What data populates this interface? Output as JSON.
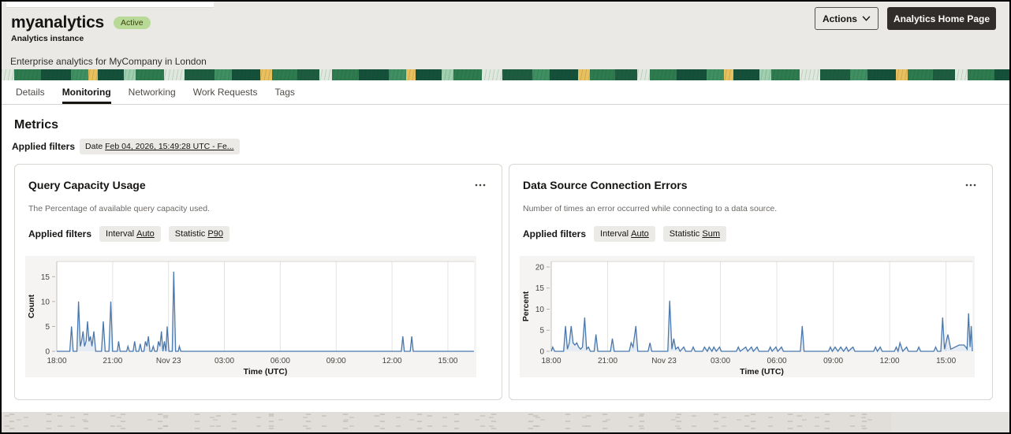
{
  "header": {
    "title": "myanalytics",
    "status_badge": "Active",
    "subtitle": "Analytics instance",
    "description": "Enterprise analytics for MyCompany in London",
    "actions_button": "Actions",
    "home_button": "Analytics Home Page"
  },
  "tabs": {
    "items": [
      {
        "label": "Details",
        "active": false
      },
      {
        "label": "Monitoring",
        "active": true
      },
      {
        "label": "Networking",
        "active": false
      },
      {
        "label": "Work Requests",
        "active": false
      },
      {
        "label": "Tags",
        "active": false
      }
    ]
  },
  "metrics": {
    "heading": "Metrics",
    "applied_filters_label": "Applied filters",
    "date_filter_prefix": "Date",
    "date_filter_value": "Feb 04, 2026, 15:49:28 UTC - Fe..."
  },
  "chart_data": [
    {
      "type": "line",
      "title": "Query Capacity Usage",
      "subtitle": "The Percentage of available query capacity used.",
      "applied_filters_label": "Applied filters",
      "filters": [
        {
          "label": "Interval",
          "value": "Auto"
        },
        {
          "label": "Statistic",
          "value": "P90"
        }
      ],
      "menu_icon": "ellipsis",
      "xlabel": "Time (UTC)",
      "ylabel": "Count",
      "yticks": [
        0,
        5,
        10,
        15
      ],
      "ylim": [
        0,
        18.05
      ],
      "xlim": [
        0,
        22.4
      ],
      "grid": true,
      "legend": "none",
      "line_color": "#4a78ad",
      "xticks": [
        {
          "h": 0,
          "label": "18:00"
        },
        {
          "h": 3,
          "label": "21:00"
        },
        {
          "h": 6,
          "label": "Nov 23"
        },
        {
          "h": 9,
          "label": "03:00"
        },
        {
          "h": 12,
          "label": "06:00"
        },
        {
          "h": 15,
          "label": "09:00"
        },
        {
          "h": 18,
          "label": "12:00"
        },
        {
          "h": 21,
          "label": "15:00"
        }
      ],
      "points": [
        [
          0,
          0
        ],
        [
          0.7,
          0
        ],
        [
          0.79,
          5
        ],
        [
          0.88,
          0
        ],
        [
          1.08,
          0
        ],
        [
          1.17,
          10
        ],
        [
          1.26,
          1
        ],
        [
          1.33,
          2
        ],
        [
          1.41,
          4
        ],
        [
          1.49,
          1
        ],
        [
          1.57,
          2
        ],
        [
          1.65,
          6
        ],
        [
          1.73,
          2
        ],
        [
          1.81,
          3
        ],
        [
          1.89,
          1
        ],
        [
          1.99,
          4
        ],
        [
          2.09,
          0
        ],
        [
          2.4,
          0
        ],
        [
          2.5,
          6
        ],
        [
          2.6,
          0
        ],
        [
          2.8,
          0
        ],
        [
          2.9,
          10
        ],
        [
          3.0,
          0
        ],
        [
          3.25,
          0
        ],
        [
          3.32,
          2
        ],
        [
          3.4,
          0
        ],
        [
          3.75,
          0
        ],
        [
          3.82,
          1
        ],
        [
          3.9,
          0
        ],
        [
          4.1,
          0
        ],
        [
          4.18,
          2
        ],
        [
          4.26,
          0
        ],
        [
          4.4,
          0
        ],
        [
          4.48,
          1.5
        ],
        [
          4.56,
          0
        ],
        [
          4.68,
          0
        ],
        [
          4.76,
          2
        ],
        [
          4.84,
          1
        ],
        [
          4.92,
          3
        ],
        [
          5.0,
          0
        ],
        [
          5.1,
          0
        ],
        [
          5.18,
          1
        ],
        [
          5.26,
          0
        ],
        [
          5.38,
          0
        ],
        [
          5.46,
          2
        ],
        [
          5.54,
          1
        ],
        [
          5.62,
          4
        ],
        [
          5.7,
          0
        ],
        [
          5.78,
          2
        ],
        [
          5.86,
          0
        ],
        [
          5.93,
          5
        ],
        [
          6.02,
          0
        ],
        [
          6.2,
          0
        ],
        [
          6.28,
          16
        ],
        [
          6.38,
          0
        ],
        [
          6.52,
          0
        ],
        [
          6.58,
          1
        ],
        [
          6.66,
          0
        ],
        [
          18.5,
          0
        ],
        [
          18.58,
          3
        ],
        [
          18.66,
          0
        ],
        [
          18.98,
          0
        ],
        [
          19.06,
          3
        ],
        [
          19.14,
          0
        ],
        [
          22.4,
          0
        ]
      ]
    },
    {
      "type": "line",
      "title": "Data Source Connection Errors",
      "subtitle": "Number of times an error occurred while connecting to a data source.",
      "applied_filters_label": "Applied filters",
      "filters": [
        {
          "label": "Interval",
          "value": "Auto"
        },
        {
          "label": "Statistic",
          "value": "Sum"
        }
      ],
      "menu_icon": "ellipsis",
      "xlabel": "Time (UTC)",
      "ylabel": "Percent",
      "yticks": [
        0,
        5,
        10,
        15,
        20
      ],
      "ylim": [
        0,
        21.3
      ],
      "xlim": [
        0,
        22.4
      ],
      "grid": true,
      "legend": "none",
      "line_color": "#4a78ad",
      "xticks": [
        {
          "h": 0,
          "label": "18:00"
        },
        {
          "h": 3,
          "label": "21:00"
        },
        {
          "h": 6,
          "label": "Nov 23"
        },
        {
          "h": 9,
          "label": "03:00"
        },
        {
          "h": 12,
          "label": "06:00"
        },
        {
          "h": 15,
          "label": "09:00"
        },
        {
          "h": 18,
          "label": "12:00"
        },
        {
          "h": 21,
          "label": "15:00"
        }
      ],
      "points": [
        [
          0,
          0
        ],
        [
          0.08,
          1
        ],
        [
          0.18,
          0
        ],
        [
          0.66,
          0
        ],
        [
          0.76,
          6
        ],
        [
          0.86,
          0.5
        ],
        [
          0.96,
          2
        ],
        [
          1.06,
          6
        ],
        [
          1.16,
          2
        ],
        [
          1.26,
          1.5
        ],
        [
          1.36,
          2
        ],
        [
          1.46,
          1
        ],
        [
          1.56,
          0.5
        ],
        [
          1.66,
          1
        ],
        [
          1.78,
          8
        ],
        [
          1.88,
          0.5
        ],
        [
          1.98,
          1
        ],
        [
          2.08,
          0
        ],
        [
          2.28,
          0
        ],
        [
          2.38,
          4
        ],
        [
          2.48,
          0
        ],
        [
          3.15,
          0
        ],
        [
          3.25,
          3
        ],
        [
          3.35,
          0
        ],
        [
          4.15,
          0
        ],
        [
          4.25,
          2
        ],
        [
          4.35,
          1
        ],
        [
          4.5,
          6
        ],
        [
          4.6,
          0
        ],
        [
          5.15,
          0
        ],
        [
          5.25,
          2
        ],
        [
          5.35,
          0
        ],
        [
          6.2,
          0
        ],
        [
          6.3,
          12
        ],
        [
          6.42,
          0.5
        ],
        [
          6.52,
          3
        ],
        [
          6.62,
          0.5
        ],
        [
          6.75,
          1
        ],
        [
          6.85,
          0
        ],
        [
          7.05,
          1
        ],
        [
          7.15,
          0
        ],
        [
          7.45,
          0
        ],
        [
          7.55,
          1
        ],
        [
          7.65,
          0
        ],
        [
          8.05,
          0
        ],
        [
          8.15,
          1
        ],
        [
          8.3,
          0
        ],
        [
          8.4,
          1
        ],
        [
          8.55,
          0
        ],
        [
          8.65,
          1
        ],
        [
          8.78,
          0
        ],
        [
          8.95,
          1
        ],
        [
          9.05,
          0
        ],
        [
          9.85,
          0
        ],
        [
          9.95,
          1
        ],
        [
          10.05,
          0
        ],
        [
          10.35,
          1
        ],
        [
          10.45,
          0
        ],
        [
          10.65,
          1
        ],
        [
          10.75,
          0
        ],
        [
          10.95,
          1
        ],
        [
          11.05,
          0
        ],
        [
          11.55,
          0
        ],
        [
          11.65,
          1
        ],
        [
          11.75,
          0
        ],
        [
          11.95,
          1
        ],
        [
          12.05,
          0
        ],
        [
          12.25,
          1
        ],
        [
          12.35,
          0
        ],
        [
          13.25,
          0
        ],
        [
          13.35,
          6
        ],
        [
          13.45,
          0
        ],
        [
          14.75,
          0
        ],
        [
          14.85,
          1
        ],
        [
          14.95,
          0
        ],
        [
          15.1,
          1
        ],
        [
          15.25,
          0
        ],
        [
          15.4,
          1
        ],
        [
          15.55,
          0
        ],
        [
          15.7,
          1
        ],
        [
          15.8,
          0
        ],
        [
          16.05,
          1
        ],
        [
          16.15,
          0
        ],
        [
          17.15,
          0
        ],
        [
          17.25,
          1
        ],
        [
          17.35,
          0
        ],
        [
          17.5,
          1
        ],
        [
          17.6,
          0
        ],
        [
          18.25,
          0
        ],
        [
          18.35,
          1
        ],
        [
          18.45,
          0
        ],
        [
          18.55,
          2
        ],
        [
          18.7,
          0
        ],
        [
          18.9,
          1
        ],
        [
          19.0,
          0
        ],
        [
          19.45,
          0
        ],
        [
          19.55,
          1
        ],
        [
          19.65,
          0
        ],
        [
          20.35,
          0
        ],
        [
          20.45,
          1
        ],
        [
          20.55,
          0
        ],
        [
          20.72,
          0
        ],
        [
          20.82,
          8
        ],
        [
          20.92,
          0.5
        ],
        [
          21.1,
          4
        ],
        [
          21.25,
          0.5
        ],
        [
          21.7,
          1.5
        ],
        [
          21.95,
          1.5
        ],
        [
          22.05,
          1
        ],
        [
          22.12,
          0.5
        ],
        [
          22.2,
          9
        ],
        [
          22.28,
          1
        ],
        [
          22.34,
          6
        ],
        [
          22.4,
          0
        ]
      ]
    }
  ]
}
